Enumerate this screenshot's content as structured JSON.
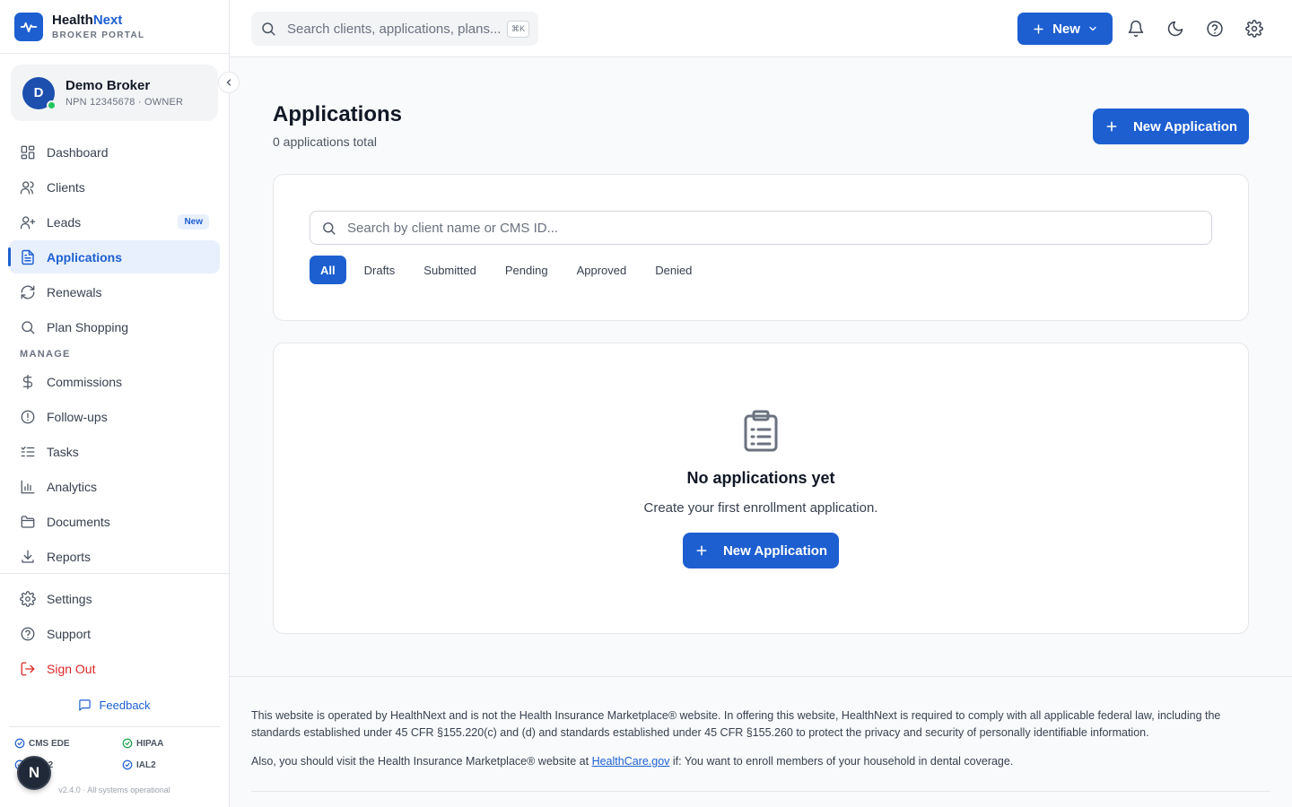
{
  "brand": {
    "name_part1": "Health",
    "name_part2": "Next",
    "subtitle": "BROKER PORTAL"
  },
  "user": {
    "initial": "D",
    "name": "Demo Broker",
    "meta": "NPN 12345678 · OWNER"
  },
  "nav": {
    "items": [
      {
        "label": "Dashboard",
        "icon": "grid-icon"
      },
      {
        "label": "Clients",
        "icon": "users-icon"
      },
      {
        "label": "Leads",
        "icon": "user-plus-icon",
        "badge": "New"
      },
      {
        "label": "Applications",
        "icon": "document-icon",
        "active": true
      },
      {
        "label": "Renewals",
        "icon": "refresh-icon"
      },
      {
        "label": "Plan Shopping",
        "icon": "search-icon"
      }
    ],
    "section_manage": "MANAGE",
    "manage_items": [
      {
        "label": "Commissions",
        "icon": "dollar-icon"
      },
      {
        "label": "Follow-ups",
        "icon": "alert-circle-icon"
      },
      {
        "label": "Tasks",
        "icon": "list-check-icon"
      },
      {
        "label": "Analytics",
        "icon": "bar-chart-icon"
      },
      {
        "label": "Documents",
        "icon": "folder-icon"
      },
      {
        "label": "Reports",
        "icon": "download-icon"
      }
    ],
    "bottom_items": [
      {
        "label": "Settings",
        "icon": "gear-icon"
      },
      {
        "label": "Support",
        "icon": "help-circle-icon"
      },
      {
        "label": "Sign Out",
        "icon": "logout-icon"
      }
    ],
    "feedback": "Feedback"
  },
  "compliance": [
    "CMS EDE",
    "HIPAA",
    "SOC2",
    "IAL2"
  ],
  "version": "v2.4.0 · All systems operational",
  "floating_badge": "N",
  "topbar": {
    "search_placeholder": "Search clients, applications, plans...",
    "shortcut": "⌘K",
    "new_label": "New"
  },
  "page": {
    "title": "Applications",
    "subtitle": "0 applications total",
    "new_button": "New Application",
    "search_placeholder": "Search by client name or CMS ID...",
    "tabs": [
      "All",
      "Drafts",
      "Submitted",
      "Pending",
      "Approved",
      "Denied"
    ],
    "active_tab": "All"
  },
  "empty_state": {
    "title": "No applications yet",
    "description": "Create your first enrollment application.",
    "button": "New Application"
  },
  "footer": {
    "disclaimer": "This website is operated by HealthNext and is not the Health Insurance Marketplace® website. In offering this website, HealthNext is required to comply with all applicable federal law, including the standards established under 45 CFR §155.220(c) and (d) and standards established under 45 CFR §155.260 to protect the privacy and security of personally identifiable information.",
    "marketplace_prefix": "Also, you should visit the Health Insurance Marketplace® website at",
    "marketplace_link": "HealthCare.gov",
    "marketplace_suffix": "if: You want to enroll members of your household in dental coverage."
  },
  "colors": {
    "primary": "#1d5fd1",
    "danger": "#dc2626",
    "success": "#22c55e"
  }
}
